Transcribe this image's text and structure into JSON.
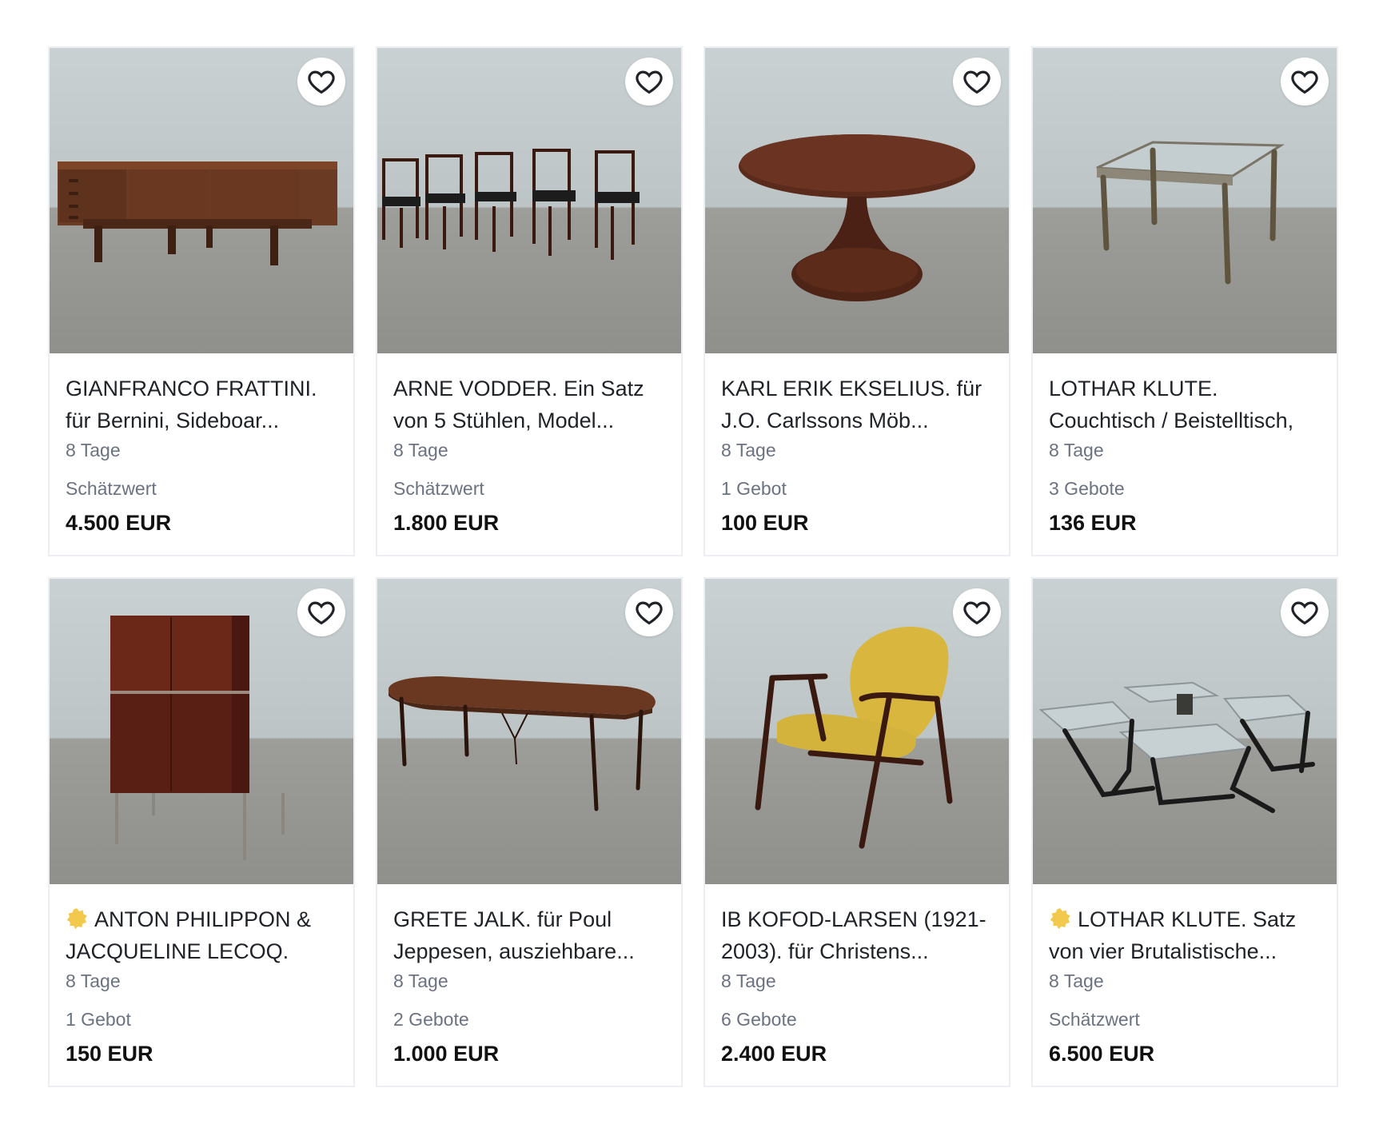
{
  "lots": [
    {
      "title": "GIANFRANCO FRATTINI. für Bernini, Sideboar...",
      "duration": "8 Tage",
      "bid_info": "Schätzwert",
      "price": "4.500 EUR",
      "badge": false,
      "image_icon": "sideboard-photo"
    },
    {
      "title": "ARNE VODDER. Ein Satz von 5 Stühlen, Model...",
      "duration": "8 Tage",
      "bid_info": "Schätzwert",
      "price": "1.800 EUR",
      "badge": false,
      "image_icon": "chairs-photo"
    },
    {
      "title": "KARL ERIK EKSELIUS. für J.O. Carlssons Möb...",
      "duration": "8 Tage",
      "bid_info": "1 Gebot",
      "price": "100 EUR",
      "badge": false,
      "image_icon": "round-table-photo"
    },
    {
      "title": "LOTHAR KLUTE. Couchtisch / Beistelltisch,",
      "duration": "8 Tage",
      "bid_info": "3 Gebote",
      "price": "136 EUR",
      "badge": false,
      "image_icon": "glass-table-photo"
    },
    {
      "title": "ANTON PHILIPPON & JACQUELINE LECOQ.",
      "duration": "8 Tage",
      "bid_info": "1 Gebot",
      "price": "150 EUR",
      "badge": true,
      "image_icon": "cabinet-photo"
    },
    {
      "title": "GRETE JALK. für Poul Jeppesen, ausziehbare...",
      "duration": "8 Tage",
      "bid_info": "2 Gebote",
      "price": "1.000 EUR",
      "badge": false,
      "image_icon": "dining-table-photo"
    },
    {
      "title": "IB KOFOD-LARSEN (1921-2003). für Christens...",
      "duration": "8 Tage",
      "bid_info": "6 Gebote",
      "price": "2.400 EUR",
      "badge": false,
      "image_icon": "armchair-photo"
    },
    {
      "title": "LOTHAR KLUTE. Satz von vier Brutalistische...",
      "duration": "8 Tage",
      "bid_info": "Schätzwert",
      "price": "6.500 EUR",
      "badge": true,
      "image_icon": "nesting-tables-photo"
    }
  ],
  "colors": {
    "badge": "#f2c94c",
    "muted_text": "#6b7280",
    "card_border": "#eceef1"
  }
}
